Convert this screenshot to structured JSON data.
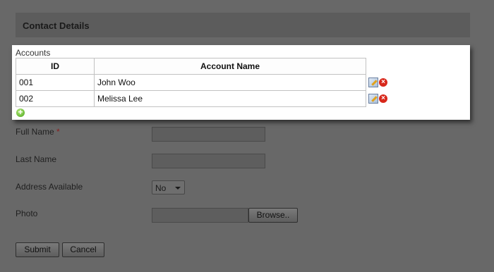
{
  "section": {
    "title": "Contact Details"
  },
  "form": {
    "full_name_label": "Full Name",
    "required_mark": "*",
    "last_name_label": "Last Name",
    "address_label": "Address Available",
    "address_value": "No",
    "photo_label": "Photo",
    "browse_label": "Browse..",
    "submit_label": "Submit",
    "cancel_label": "Cancel"
  },
  "dialog": {
    "title": "Accounts",
    "columns": [
      "ID",
      "Account Name"
    ],
    "rows": [
      {
        "id": "001",
        "name": "John Woo"
      },
      {
        "id": "002",
        "name": "Melissa Lee"
      }
    ],
    "icons": {
      "edit": "edit-icon",
      "delete": "delete-icon",
      "add": "add-icon"
    }
  },
  "colors": {
    "overlay_background": "#686868",
    "delete_red": "#d8281b",
    "add_green": "#48a21a"
  }
}
